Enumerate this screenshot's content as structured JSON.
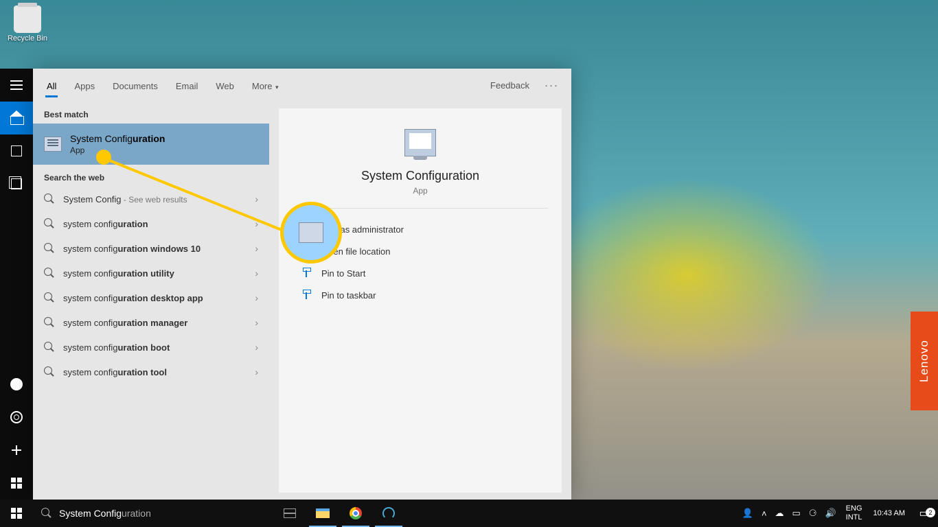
{
  "desktop": {
    "recycle_bin": "Recycle Bin"
  },
  "search": {
    "tabs": [
      "All",
      "Apps",
      "Documents",
      "Email",
      "Web",
      "More"
    ],
    "feedback": "Feedback",
    "best_match_label": "Best match",
    "best_match": {
      "title_strong": "System Config",
      "title_rest": "uration",
      "subtitle": "App"
    },
    "web_label": "Search the web",
    "web_results": [
      {
        "pre": "System Config",
        "bold": "",
        "post": "",
        "suffix": " - See web results"
      },
      {
        "pre": "system config",
        "bold": "uration",
        "post": "",
        "suffix": ""
      },
      {
        "pre": "system config",
        "bold": "uration windows 10",
        "post": "",
        "suffix": ""
      },
      {
        "pre": "system config",
        "bold": "uration utility",
        "post": "",
        "suffix": ""
      },
      {
        "pre": "system config",
        "bold": "uration desktop app",
        "post": "",
        "suffix": ""
      },
      {
        "pre": "system config",
        "bold": "uration manager",
        "post": "",
        "suffix": ""
      },
      {
        "pre": "system config",
        "bold": "uration boot",
        "post": "",
        "suffix": ""
      },
      {
        "pre": "system config",
        "bold": "uration tool",
        "post": "",
        "suffix": ""
      }
    ],
    "detail": {
      "title": "System Configuration",
      "subtitle": "App",
      "actions": [
        "Run as administrator",
        "Open file location",
        "Pin to Start",
        "Pin to taskbar"
      ]
    },
    "input_typed": "System Config",
    "input_ghost": "uration"
  },
  "lenovo": "Lenovo",
  "tray": {
    "lang1": "ENG",
    "lang2": "INTL",
    "time": "10:43 AM",
    "notif_count": "2"
  }
}
